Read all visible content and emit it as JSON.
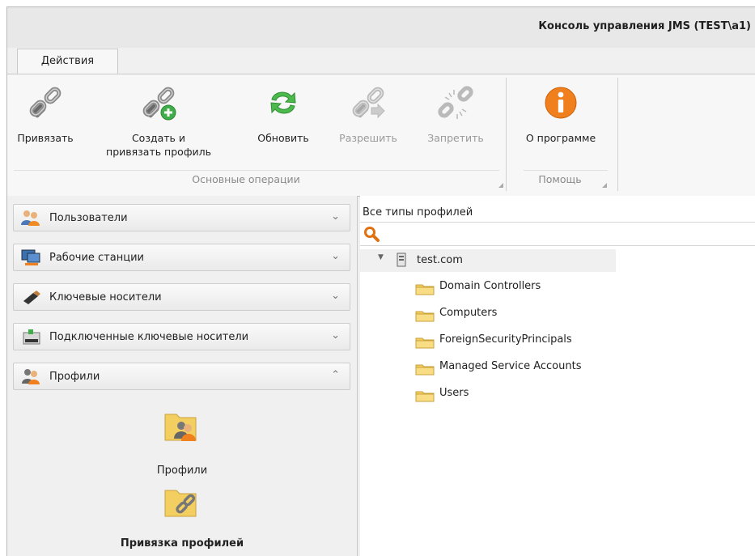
{
  "window": {
    "title": "Консоль управления JMS (TEST\\a1)"
  },
  "ribbon": {
    "tabs": [
      {
        "label": "Действия",
        "active": true
      }
    ],
    "groups": [
      {
        "label": "Основные операции",
        "buttons": [
          {
            "label": "Привязать",
            "icon": "link-icon",
            "enabled": true
          },
          {
            "label": "Создать и",
            "label2": "привязать профиль",
            "icon": "link-add-icon",
            "enabled": true
          },
          {
            "label": "Обновить",
            "icon": "refresh-icon",
            "enabled": true
          },
          {
            "label": "Разрешить",
            "icon": "link-allow-icon",
            "enabled": false
          },
          {
            "label": "Запретить",
            "icon": "link-break-icon",
            "enabled": false
          }
        ]
      },
      {
        "label": "Помощь",
        "buttons": [
          {
            "label": "О программе",
            "icon": "info-icon",
            "enabled": true
          }
        ]
      }
    ]
  },
  "navigation": {
    "sections": [
      {
        "label": "Пользователи",
        "icon": "users-icon",
        "expanded": false
      },
      {
        "label": "Рабочие станции",
        "icon": "workstations-icon",
        "expanded": false
      },
      {
        "label": "Ключевые носители",
        "icon": "usb-token-icon",
        "expanded": false
      },
      {
        "label": "Подключенные ключевые носители",
        "icon": "connected-token-icon",
        "expanded": false
      },
      {
        "label": "Профили",
        "icon": "profiles-icon",
        "expanded": true
      }
    ],
    "profile_items": [
      {
        "label": "Профили",
        "icon": "profiles-folder-icon",
        "selected": false
      },
      {
        "label": "Привязка профилей",
        "icon": "profile-binding-folder-icon",
        "selected": true
      }
    ]
  },
  "content": {
    "filter": "Все типы профилей",
    "search": {
      "value": "",
      "icon": "search-icon"
    },
    "tree": {
      "root": {
        "label": "test.com",
        "expanded": true,
        "icon": "domain-icon"
      },
      "children": [
        {
          "label": "Domain Controllers"
        },
        {
          "label": "Computers"
        },
        {
          "label": "ForeignSecurityPrincipals"
        },
        {
          "label": "Managed Service Accounts"
        },
        {
          "label": "Users"
        }
      ]
    }
  },
  "colors": {
    "accent_green": "#3fae49",
    "info_orange": "#f07f1d",
    "folder_yellow": "#f6d56a"
  }
}
